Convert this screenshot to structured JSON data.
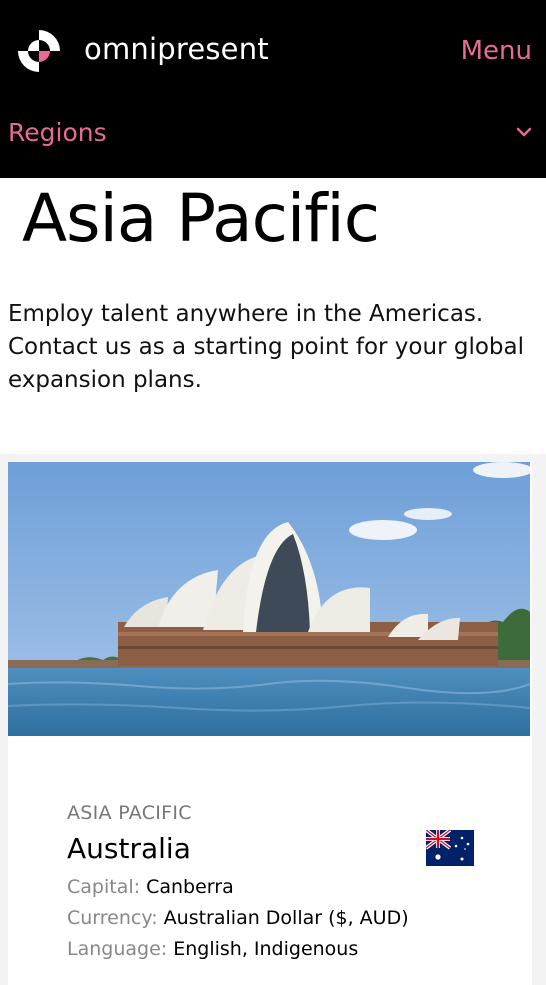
{
  "header": {
    "brand": "omnipresent",
    "menu_label": "Menu",
    "regions_label": "Regions",
    "accent_color": "#e86b95",
    "background": "#000000",
    "logo_icon": "omnipresent-logo-icon",
    "dropdown_icon": "chevron-down-icon"
  },
  "page": {
    "title": "Asia Pacific",
    "intro": "Employ talent anywhere in the Americas. Contact us as a starting point for your global expansion plans."
  },
  "cards": [
    {
      "image": "sydney-opera-house-photo",
      "region": "ASIA PACIFIC",
      "country": "Australia",
      "flag_icon": "australia-flag-icon",
      "capital_label": "Capital:",
      "capital": "Canberra",
      "currency_label": "Currency:",
      "currency": "Australian Dollar ($, AUD)",
      "language_label": "Language:",
      "language": "English, Indigenous"
    }
  ]
}
